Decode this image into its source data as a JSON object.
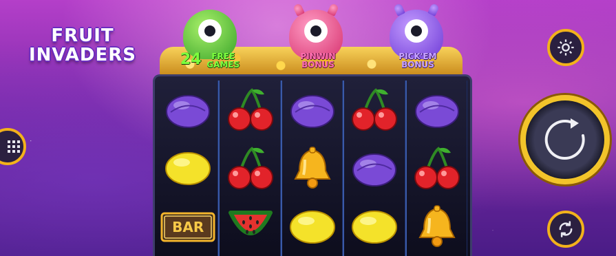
{
  "logo": {
    "line1": "FRUIT",
    "line2": "INVADERS"
  },
  "features": {
    "free_games_count": "24",
    "free_games_word1": "FREE",
    "free_games_word2": "GAMES",
    "pinwin_line1": "PINWIN",
    "pinwin_line2": "BONUS",
    "pickem_line1": "PICK'EM",
    "pickem_line2": "BONUS"
  },
  "reels": [
    [
      "plum",
      "lemon",
      "bar"
    ],
    [
      "cherries",
      "cherries",
      "watermelon"
    ],
    [
      "plum",
      "bell",
      "lemon"
    ],
    [
      "cherries",
      "plum",
      "lemon"
    ],
    [
      "plum",
      "cherries",
      "bell"
    ]
  ],
  "bar_symbol_text": "BAR",
  "controls": {
    "settings_icon": "gear-icon",
    "menu_icon": "grid-menu-icon",
    "spin_icon": "spin-arrow-icon",
    "autoplay_icon": "autoplay-refresh-icon"
  },
  "colors": {
    "accent_gold": "#f2b21b",
    "reel_divider": "#3a5aa8"
  }
}
